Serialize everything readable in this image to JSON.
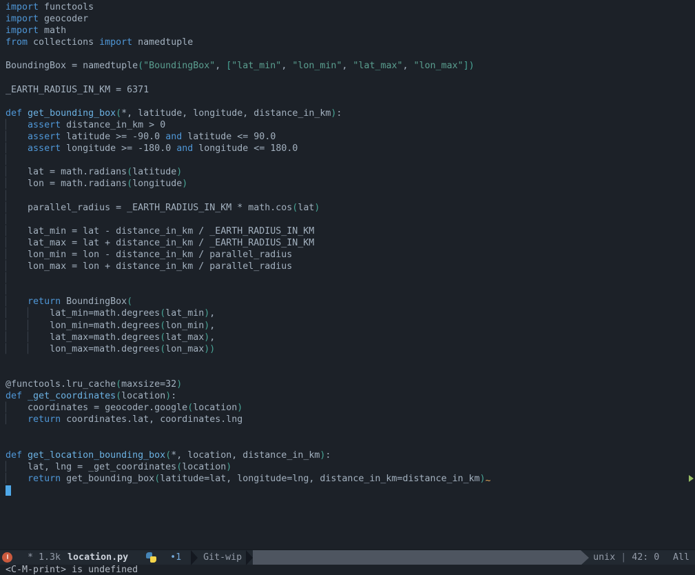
{
  "colors": {
    "background": "#1c2128",
    "modeline_background": "#222931",
    "default_text": "#a3b1bf",
    "keyword": "#4f97d7",
    "function_name": "#6cb2e3",
    "string": "#5a9e8f",
    "delimiter": "#48a596",
    "indent_guide": "#3a414c",
    "cursor": "#4fa8e8",
    "warning_squiggle": "#e0a458",
    "fringe_arrow": "#98be65",
    "error_indicator": "#cb5a3e",
    "modeline_bar": "#4e5560",
    "powerline_separator": "#141820",
    "python_icon_blue": "#4584b6",
    "python_icon_yellow": "#f5d54a"
  },
  "icons": {
    "left_circle": "error-indicator-circle",
    "file_type": "python-logo",
    "separators": "powerline-right-triangle",
    "fringe": "right-arrow"
  },
  "editor": {
    "code_lines": [
      [
        [
          "k",
          "import"
        ],
        [
          "t",
          " functools"
        ]
      ],
      [
        [
          "k",
          "import"
        ],
        [
          "t",
          " geocoder"
        ]
      ],
      [
        [
          "k",
          "import"
        ],
        [
          "t",
          " math"
        ]
      ],
      [
        [
          "k",
          "from"
        ],
        [
          "t",
          " collections "
        ],
        [
          "k",
          "import"
        ],
        [
          "t",
          " namedtuple"
        ]
      ],
      [],
      [
        [
          "t",
          "BoundingBox = namedtuple"
        ],
        [
          "p",
          "("
        ],
        [
          "s",
          "\"BoundingBox\""
        ],
        [
          "t",
          ", "
        ],
        [
          "p",
          "["
        ],
        [
          "s",
          "\"lat_min\""
        ],
        [
          "t",
          ", "
        ],
        [
          "s",
          "\"lon_min\""
        ],
        [
          "t",
          ", "
        ],
        [
          "s",
          "\"lat_max\""
        ],
        [
          "t",
          ", "
        ],
        [
          "s",
          "\"lon_max\""
        ],
        [
          "p",
          "])"
        ]
      ],
      [],
      [
        [
          "t",
          "_EARTH_RADIUS_IN_KM = 6371"
        ]
      ],
      [],
      [
        [
          "k",
          "def"
        ],
        [
          "t",
          " "
        ],
        [
          "f",
          "get_bounding_box"
        ],
        [
          "p",
          "("
        ],
        [
          "t",
          "*, latitude, longitude, distance_in_km"
        ],
        [
          "p",
          ")"
        ],
        [
          "t",
          ":"
        ]
      ],
      [
        [
          "g",
          "▏"
        ],
        [
          "t",
          "   "
        ],
        [
          "k",
          "assert"
        ],
        [
          "t",
          " distance_in_km > 0"
        ]
      ],
      [
        [
          "g",
          "▏"
        ],
        [
          "t",
          "   "
        ],
        [
          "k",
          "assert"
        ],
        [
          "t",
          " latitude >= -90.0 "
        ],
        [
          "k",
          "and"
        ],
        [
          "t",
          " latitude <= 90.0"
        ]
      ],
      [
        [
          "g",
          "▏"
        ],
        [
          "t",
          "   "
        ],
        [
          "k",
          "assert"
        ],
        [
          "t",
          " longitude >= -180.0 "
        ],
        [
          "k",
          "and"
        ],
        [
          "t",
          " longitude <= 180.0"
        ]
      ],
      [
        [
          "g",
          "▏"
        ]
      ],
      [
        [
          "g",
          "▏"
        ],
        [
          "t",
          "   lat = math.radians"
        ],
        [
          "p",
          "("
        ],
        [
          "t",
          "latitude"
        ],
        [
          "p",
          ")"
        ]
      ],
      [
        [
          "g",
          "▏"
        ],
        [
          "t",
          "   lon = math.radians"
        ],
        [
          "p",
          "("
        ],
        [
          "t",
          "longitude"
        ],
        [
          "p",
          ")"
        ]
      ],
      [
        [
          "g",
          "▏"
        ]
      ],
      [
        [
          "g",
          "▏"
        ],
        [
          "t",
          "   parallel_radius = _EARTH_RADIUS_IN_KM * math.cos"
        ],
        [
          "p",
          "("
        ],
        [
          "t",
          "lat"
        ],
        [
          "p",
          ")"
        ]
      ],
      [
        [
          "g",
          "▏"
        ]
      ],
      [
        [
          "g",
          "▏"
        ],
        [
          "t",
          "   lat_min = lat - distance_in_km / _EARTH_RADIUS_IN_KM"
        ]
      ],
      [
        [
          "g",
          "▏"
        ],
        [
          "t",
          "   lat_max = lat + distance_in_km / _EARTH_RADIUS_IN_KM"
        ]
      ],
      [
        [
          "g",
          "▏"
        ],
        [
          "t",
          "   lon_min = lon - distance_in_km / parallel_radius"
        ]
      ],
      [
        [
          "g",
          "▏"
        ],
        [
          "t",
          "   lon_max = lon + distance_in_km / parallel_radius"
        ]
      ],
      [
        [
          "g",
          "▏"
        ]
      ],
      [
        [
          "g",
          "▏"
        ]
      ],
      [
        [
          "g",
          "▏"
        ],
        [
          "t",
          "   "
        ],
        [
          "k",
          "return"
        ],
        [
          "t",
          " BoundingBox"
        ],
        [
          "p",
          "("
        ]
      ],
      [
        [
          "g",
          "▏"
        ],
        [
          "t",
          "   "
        ],
        [
          "g",
          "▏"
        ],
        [
          "t",
          "   lat_min=math.degrees"
        ],
        [
          "p",
          "("
        ],
        [
          "t",
          "lat_min"
        ],
        [
          "p",
          ")"
        ],
        [
          "t",
          ","
        ]
      ],
      [
        [
          "g",
          "▏"
        ],
        [
          "t",
          "   "
        ],
        [
          "g",
          "▏"
        ],
        [
          "t",
          "   lon_min=math.degrees"
        ],
        [
          "p",
          "("
        ],
        [
          "t",
          "lon_min"
        ],
        [
          "p",
          ")"
        ],
        [
          "t",
          ","
        ]
      ],
      [
        [
          "g",
          "▏"
        ],
        [
          "t",
          "   "
        ],
        [
          "g",
          "▏"
        ],
        [
          "t",
          "   lat_max=math.degrees"
        ],
        [
          "p",
          "("
        ],
        [
          "t",
          "lat_max"
        ],
        [
          "p",
          ")"
        ],
        [
          "t",
          ","
        ]
      ],
      [
        [
          "g",
          "▏"
        ],
        [
          "t",
          "   "
        ],
        [
          "g",
          "▏"
        ],
        [
          "t",
          "   lon_max=math.degrees"
        ],
        [
          "p",
          "("
        ],
        [
          "t",
          "lon_max"
        ],
        [
          "p",
          "))"
        ]
      ],
      [],
      [],
      [
        [
          "t",
          "@functools.lru_cache"
        ],
        [
          "p",
          "("
        ],
        [
          "t",
          "maxsize=32"
        ],
        [
          "p",
          ")"
        ]
      ],
      [
        [
          "k",
          "def"
        ],
        [
          "t",
          " "
        ],
        [
          "f",
          "_get_coordinates"
        ],
        [
          "p",
          "("
        ],
        [
          "t",
          "location"
        ],
        [
          "p",
          ")"
        ],
        [
          "t",
          ":"
        ]
      ],
      [
        [
          "g",
          "▏"
        ],
        [
          "t",
          "   coordinates = geocoder.google"
        ],
        [
          "p",
          "("
        ],
        [
          "t",
          "location"
        ],
        [
          "p",
          ")"
        ]
      ],
      [
        [
          "g",
          "▏"
        ],
        [
          "t",
          "   "
        ],
        [
          "k",
          "return"
        ],
        [
          "t",
          " coordinates.lat, coordinates.lng"
        ]
      ],
      [],
      [],
      [
        [
          "k",
          "def"
        ],
        [
          "t",
          " "
        ],
        [
          "f",
          "get_location_bounding_box"
        ],
        [
          "p",
          "("
        ],
        [
          "t",
          "*, location, distance_in_km"
        ],
        [
          "p",
          ")"
        ],
        [
          "t",
          ":"
        ]
      ],
      [
        [
          "g",
          "▏"
        ],
        [
          "t",
          "   lat, lng = _get_coordinates"
        ],
        [
          "p",
          "("
        ],
        [
          "t",
          "location"
        ],
        [
          "p",
          ")"
        ]
      ],
      [
        [
          "g",
          "▏"
        ],
        [
          "t",
          "   "
        ],
        [
          "k",
          "return"
        ],
        [
          "t",
          " get_bounding_box"
        ],
        [
          "p",
          "("
        ],
        [
          "t",
          "latitude=lat, longitude=lng, distance_in_km=distance_in_km"
        ],
        [
          "p",
          ")"
        ],
        [
          "w",
          "~"
        ]
      ],
      [
        [
          "c",
          " "
        ]
      ]
    ]
  },
  "statusbar": {
    "modified_flag": "*",
    "file_size": "1.3k",
    "filename": "location.py",
    "window_number": "•1",
    "git_branch": "Git-wip",
    "encoding": "unix",
    "separator": "|",
    "cursor_position": "42: 0",
    "scroll_position": "All"
  },
  "echo_area": {
    "message": "<C-M-print> is undefined"
  }
}
